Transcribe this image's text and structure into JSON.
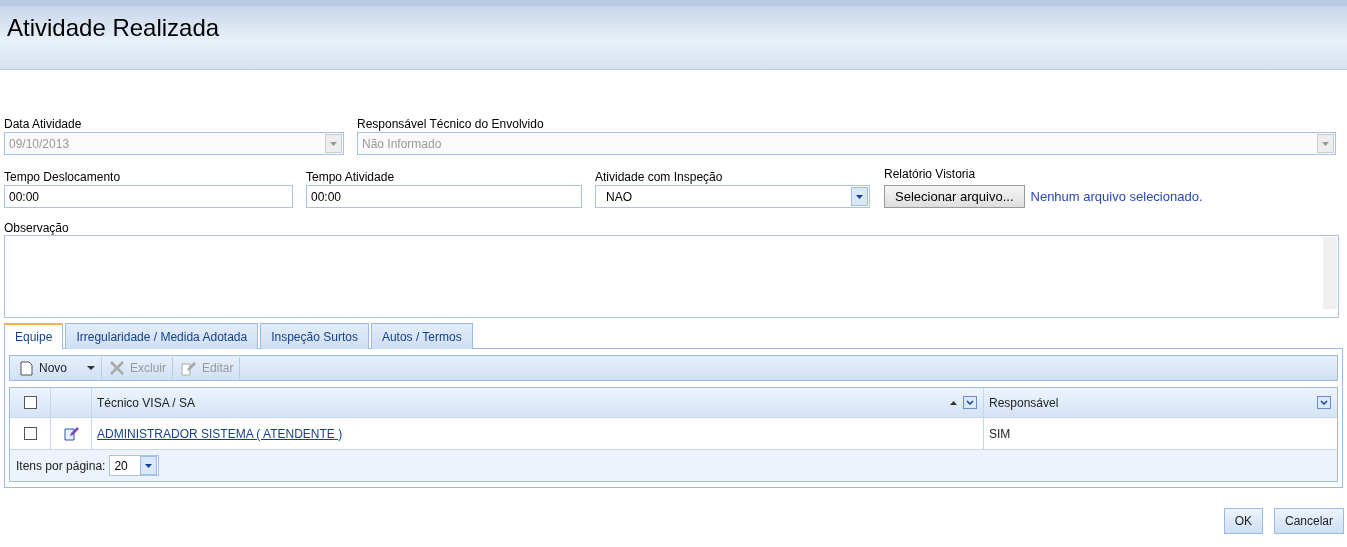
{
  "window": {
    "title": "Atividade Realizada"
  },
  "fields_row1": [
    {
      "label": "Data Atividade",
      "value": "09/10/2013",
      "disabled": true,
      "kind": "combo"
    },
    {
      "label": "Responsável Técnico do Envolvido",
      "value": "Não Informado",
      "disabled": true,
      "kind": "combo"
    }
  ],
  "fields_row2": [
    {
      "label": "Tempo Deslocamento",
      "value": "00:00",
      "disabled": false,
      "kind": "text"
    },
    {
      "label": "Tempo Atividade",
      "value": "00:00",
      "disabled": false,
      "kind": "text"
    },
    {
      "label": "Atividade com Inspeção",
      "value": "NAO",
      "disabled": false,
      "kind": "combo"
    }
  ],
  "file": {
    "label": "Relatório Vistoria",
    "button": "Selecionar arquivo...",
    "status": "Nenhum arquivo selecionado."
  },
  "observacao": {
    "label": "Observação"
  },
  "tabs": [
    {
      "label": "Equipe",
      "selected": true
    },
    {
      "label": "Irregularidade / Medida Adotada",
      "selected": false
    },
    {
      "label": "Inspeção Surtos",
      "selected": false
    },
    {
      "label": "Autos / Termos",
      "selected": false
    }
  ],
  "toolbar": [
    {
      "label": "Novo",
      "kind": "new",
      "disabled": false
    },
    {
      "label": "Excluir",
      "kind": "delete",
      "disabled": true
    },
    {
      "label": "Editar",
      "kind": "edit",
      "disabled": true
    }
  ],
  "grid": {
    "header_checked": false,
    "columns": [
      {
        "label": "Técnico VISA / SA",
        "sorted_ascending": true
      },
      {
        "label": "Responsável",
        "sorted_ascending": false
      }
    ],
    "rows": [
      {
        "checked": false,
        "tecnico": "ADMINISTRADOR SISTEMA ( ATENDENTE )",
        "responsavel": "SIM"
      }
    ],
    "pager": {
      "label": "Itens por página:",
      "value": "20"
    }
  },
  "buttons": [
    "OK",
    "Cancelar"
  ]
}
